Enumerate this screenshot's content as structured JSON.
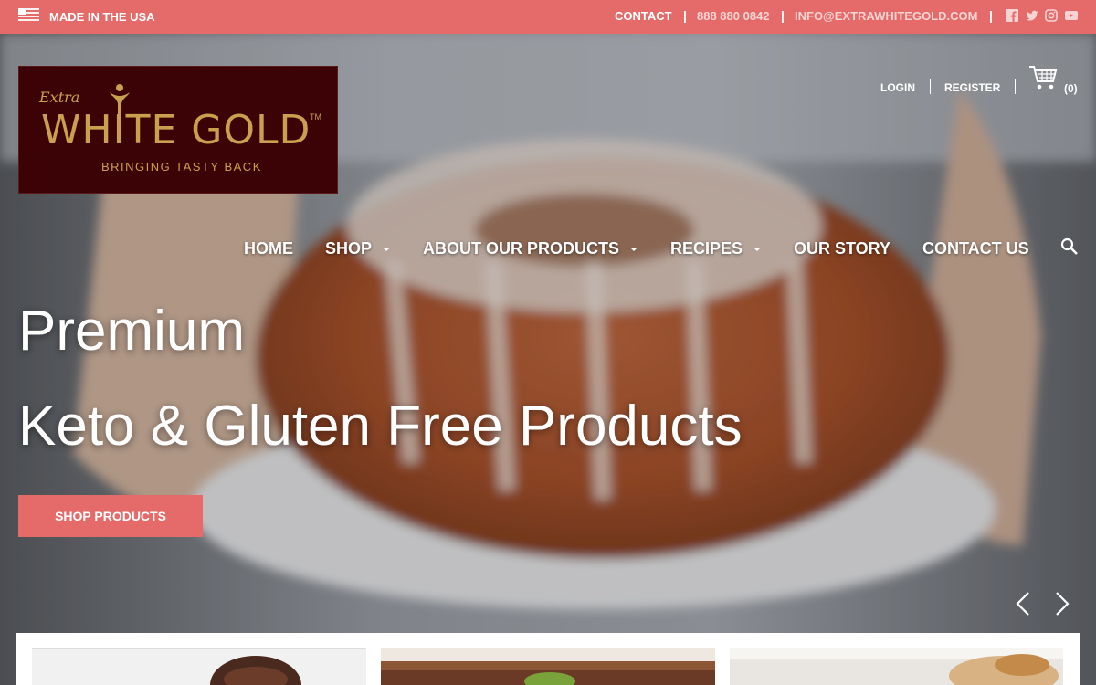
{
  "topbar": {
    "made_in": "MADE IN THE USA",
    "contact": "CONTACT",
    "separator": "|",
    "phone": "888 880 0842",
    "email": "INFO@EXTRAWHITEGOLD.COM",
    "icons": [
      "flag-icon",
      "facebook-icon",
      "twitter-icon",
      "instagram-icon",
      "youtube-icon"
    ]
  },
  "logo": {
    "extra": "Extra",
    "brand": "WHITE GOLD",
    "tm": "TM",
    "tagline": "BRINGING TASTY BACK"
  },
  "account": {
    "login": "LOGIN",
    "register": "REGISTER",
    "cart_count": "(0)"
  },
  "nav": {
    "home": "HOME",
    "shop": "SHOP",
    "about": "ABOUT OUR PRODUCTS",
    "recipes": "RECIPES",
    "story": "OUR STORY",
    "contact": "CONTACT US"
  },
  "hero": {
    "line1": "Premium",
    "line2": "Keto & Gluten Free Products",
    "cta": "SHOP PRODUCTS"
  },
  "colors": {
    "accent": "#e56b6b",
    "logo_bg": "#3b0305",
    "logo_gold": "#c9a04d"
  }
}
